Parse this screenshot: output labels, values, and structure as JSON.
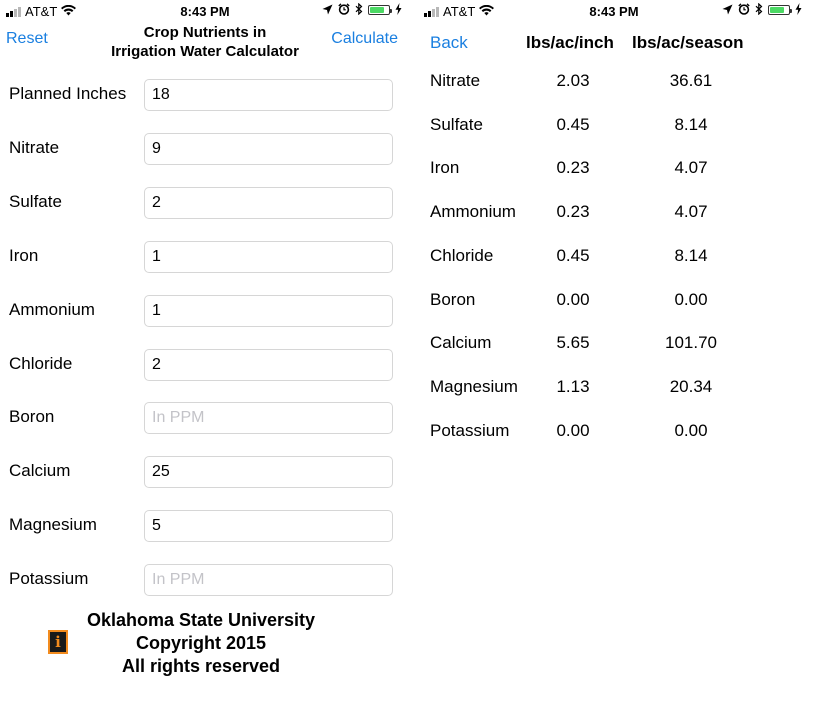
{
  "status_bar": {
    "left": {
      "carrier": "AT&T",
      "time": "8:43 PM"
    },
    "right": {
      "carrier": "AT&T",
      "time": "8:43 PM"
    },
    "battery_level": 0.75
  },
  "calculator": {
    "reset_label": "Reset",
    "title_line1": "Crop Nutrients in",
    "title_line2": "Irrigation Water Calculator",
    "calculate_label": "Calculate",
    "fields": [
      {
        "label": "Planned Inches",
        "value": "18",
        "placeholder": ""
      },
      {
        "label": "Nitrate",
        "value": "9",
        "placeholder": ""
      },
      {
        "label": "Sulfate",
        "value": "2",
        "placeholder": ""
      },
      {
        "label": "Iron",
        "value": "1",
        "placeholder": ""
      },
      {
        "label": "Ammonium",
        "value": "1",
        "placeholder": ""
      },
      {
        "label": "Chloride",
        "value": "2",
        "placeholder": ""
      },
      {
        "label": "Boron",
        "value": "",
        "placeholder": "In PPM"
      },
      {
        "label": "Calcium",
        "value": "25",
        "placeholder": ""
      },
      {
        "label": "Magnesium",
        "value": "5",
        "placeholder": ""
      },
      {
        "label": "Potassium",
        "value": "",
        "placeholder": "In PPM"
      }
    ],
    "footer": {
      "line1": "Oklahoma State University",
      "line2": "Copyright 2015",
      "line3": "All rights reserved"
    }
  },
  "results": {
    "back_label": "Back",
    "col_inch": "lbs/ac/inch",
    "col_season": "lbs/ac/season",
    "rows": [
      {
        "name": "Nitrate",
        "inch": "2.03",
        "season": "36.61"
      },
      {
        "name": "Sulfate",
        "inch": "0.45",
        "season": "8.14"
      },
      {
        "name": "Iron",
        "inch": "0.23",
        "season": "4.07"
      },
      {
        "name": "Ammonium",
        "inch": "0.23",
        "season": "4.07"
      },
      {
        "name": "Chloride",
        "inch": "0.45",
        "season": "8.14"
      },
      {
        "name": "Boron",
        "inch": "0.00",
        "season": "0.00"
      },
      {
        "name": "Calcium",
        "inch": "5.65",
        "season": "101.70"
      },
      {
        "name": "Magnesium",
        "inch": "1.13",
        "season": "20.34"
      },
      {
        "name": "Potassium",
        "inch": "0.00",
        "season": "0.00"
      }
    ]
  },
  "colors": {
    "link": "#1a7fe0",
    "battery": "#4cd964",
    "info_icon": "#f28b1e"
  }
}
